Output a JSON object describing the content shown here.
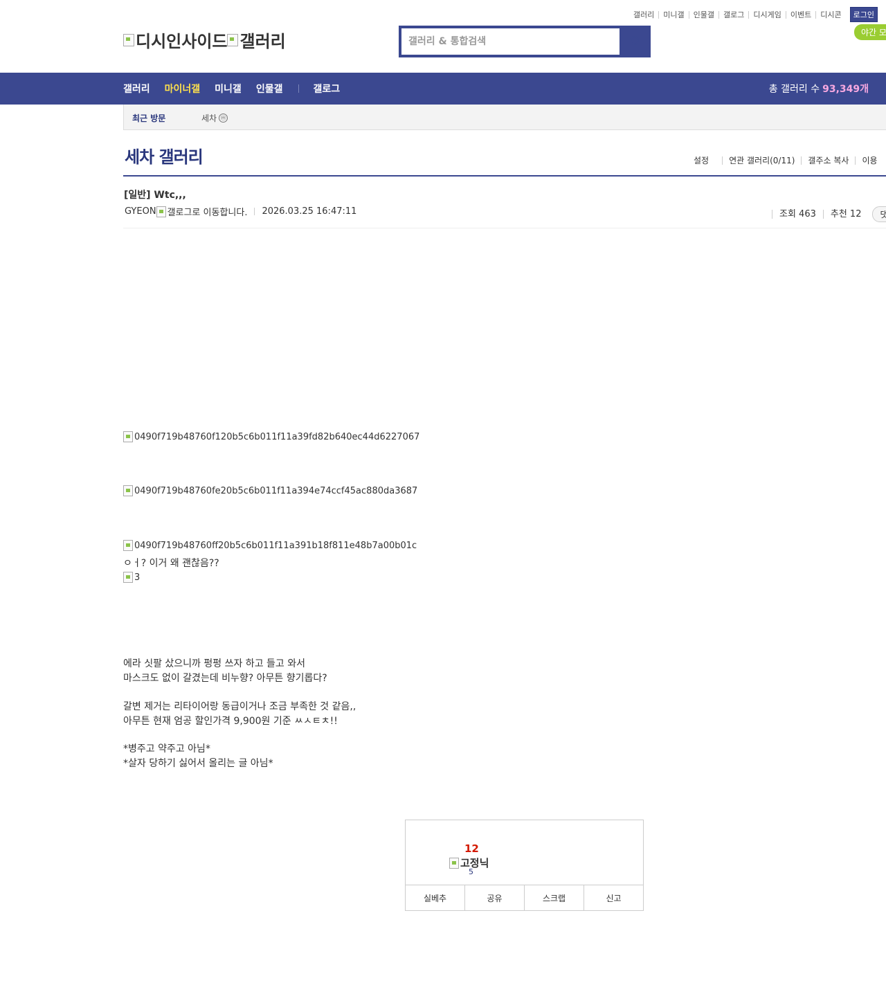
{
  "top_links": [
    "갤러리",
    "미니갤",
    "인물갤",
    "갤로그",
    "디시게임",
    "이벤트",
    "디시콘"
  ],
  "login_label": "로그인",
  "night_mode_label": "야간 모",
  "logo": {
    "site_alt": "디시인사이드",
    "gallery_alt": "갤러리"
  },
  "search": {
    "placeholder": "갤러리 & 통합검색",
    "icon": "search-icon"
  },
  "nav": {
    "items": [
      "갤러리",
      "마이너갤",
      "미니갤",
      "인물갤"
    ],
    "gallog": "갤로그",
    "total_label": "총 갤러리 수",
    "total_value": "93,349개"
  },
  "recent": {
    "label": "최근 방문",
    "item": "세차",
    "badge": "ⓜ"
  },
  "gallery": {
    "title": "세차 갤러리",
    "tools": [
      "설정",
      "연관 갤러리(0/11)",
      "갤주소 복사",
      "이용"
    ]
  },
  "post": {
    "title": "[일반] Wtc,,,",
    "writer": "GYEON",
    "gallog_alt": "갤로그로 이동합니다.",
    "date": "2026.03.25 16:47:11",
    "views": "조회 463",
    "recommend": "추천 12",
    "comment_btn": "댓"
  },
  "body": {
    "images": [
      "0490f719b48760f120b5c6b011f11a39fd82b640ec44d6227067",
      "0490f719b48760fe20b5c6b011f11a394e74ccf45ac880da3687",
      "0490f719b48760ff20b5c6b011f11a391b18f811e48b7a00b01c"
    ],
    "line1": "ㅇㅓ? 이거 왜 괜찮음??",
    "image4": "3",
    "paragraphs": [
      "에라 싯팔 샀으니까 펑펑 쓰자 하고 들고 와서",
      "마스크도 없이 갈겼는데 비누향? 아무튼 향기롭다?",
      "",
      "갈변 제거는 리타이어랑 동급이거나 조금 부족한 것 같음,,",
      "아무튼 현재 엄공 할인가격 9,900원 기준 ㅆㅅㅌㅊ!!",
      "",
      "*병주고 약주고 아님*",
      "*살자 당하기 싫어서 올리는 글 아님*"
    ]
  },
  "recommend_box": {
    "count": "12",
    "fixed_alt": "고정닉",
    "fixed_count": "5",
    "buttons": [
      "실베추",
      "공유",
      "스크랩",
      "신고"
    ]
  },
  "colors": {
    "brand": "#3b4890",
    "title": "#29367c",
    "highlight": "#ffe14c",
    "total_num": "#f7a8e0",
    "recommend": "#d31900",
    "night": "#9acd32"
  }
}
